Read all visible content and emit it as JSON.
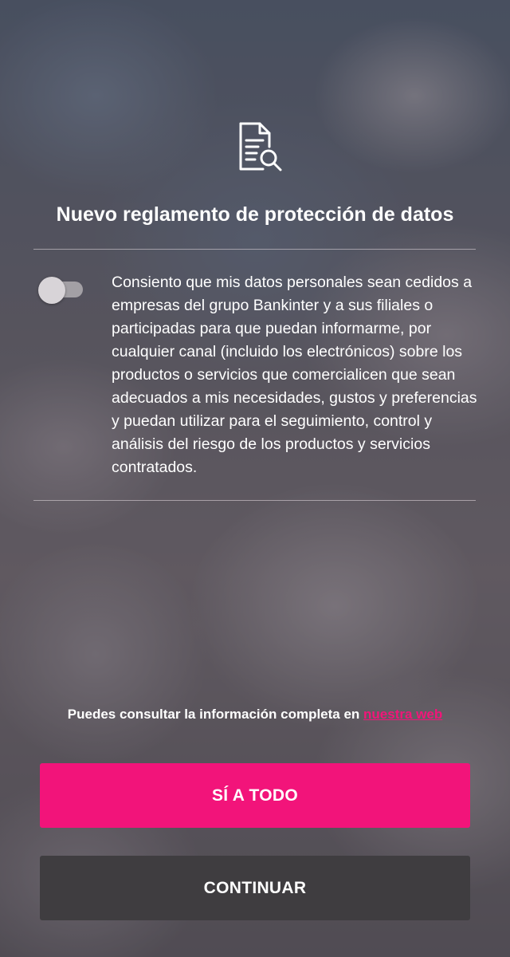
{
  "header": {
    "icon": "document-search-icon",
    "title": "Nuevo reglamento de protección de datos"
  },
  "consent": {
    "toggle_on": false,
    "text": "Consiento que mis datos personales sean cedidos a empresas del grupo Bankinter y a sus filiales o participadas para que puedan informarme, por cualquier canal (incluido los electrónicos) sobre los productos o servicios que comercialicen que sean adecuados a mis necesidades, gustos y preferencias y puedan utilizar para el seguimiento, control y análisis del riesgo de los productos y servicios contratados."
  },
  "info": {
    "text": "Puedes consultar la información completa en ",
    "link_label": "nuestra web"
  },
  "actions": {
    "accept_all_label": "SÍ A TODO",
    "continue_label": "CONTINUAR"
  },
  "colors": {
    "accent": "#f2147a",
    "secondary_button": "#3f3d40"
  }
}
